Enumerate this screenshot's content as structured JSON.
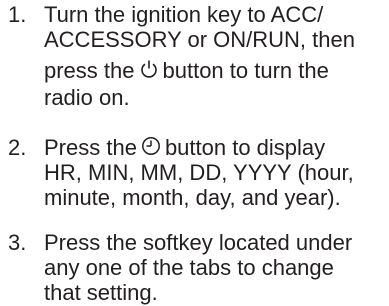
{
  "steps": [
    {
      "number": "1.",
      "lines": [
        "Turn the ignition key to ACC/",
        "ACCESSORY or ON/RUN, then"
      ],
      "icon_line_before": "press the",
      "icon_line_icon": "power-icon",
      "icon_line_after": "button to turn the",
      "last_line": "radio on."
    },
    {
      "number": "2.",
      "icon_line_before": "Press the",
      "icon_line_icon": "clock-icon",
      "icon_line_after": "button to display",
      "lines": [
        "HR, MIN, MM, DD, YYYY (hour,",
        "minute, month, day, and year)."
      ]
    },
    {
      "number": "3.",
      "lines": [
        "Press the softkey located under",
        "any one of the tabs to change",
        "that setting."
      ]
    }
  ]
}
